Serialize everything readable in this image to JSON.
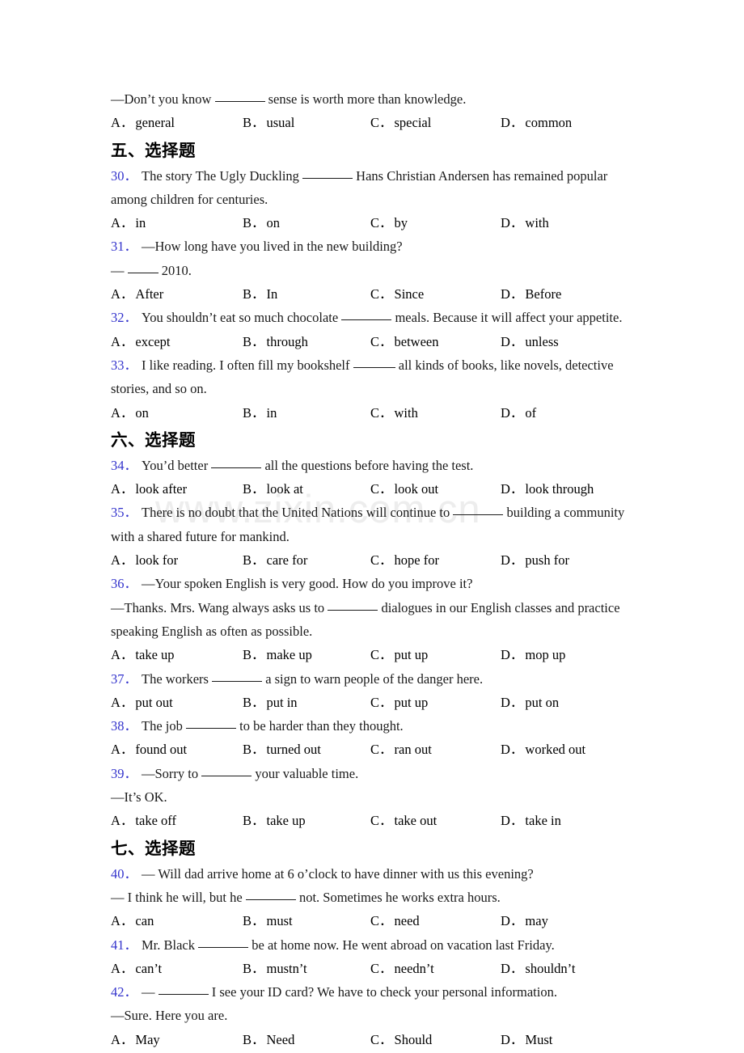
{
  "page": {
    "watermark": "www.zixin.com.cn",
    "accent_number_color": "#3333cc",
    "text_color": "#1a1a1a",
    "background_color": "#ffffff"
  },
  "intro": {
    "stem": "—Don’t you know ________ sense is worth more than knowledge.",
    "stem_pre": "—Don’t you know",
    "stem_post": "sense is worth more than knowledge.",
    "options": [
      {
        "tag": "A．",
        "text": "general"
      },
      {
        "tag": "B．",
        "text": "usual"
      },
      {
        "tag": "C．",
        "text": "special"
      },
      {
        "tag": "D．",
        "text": "common"
      }
    ]
  },
  "sections": [
    {
      "heading": "五、选择题",
      "questions": [
        {
          "number": "30．",
          "lines": [
            {
              "pre": "The story The Ugly Duckling",
              "blank": "b-lg",
              "post": "Hans Christian Andersen has remained popular"
            },
            {
              "pre": "among children for centuries.",
              "blank": null,
              "post": ""
            }
          ],
          "options": [
            {
              "tag": "A．",
              "text": "in"
            },
            {
              "tag": "B．",
              "text": "on"
            },
            {
              "tag": "C．",
              "text": "by"
            },
            {
              "tag": "D．",
              "text": "with"
            }
          ]
        },
        {
          "number": "31．",
          "lines": [
            {
              "pre": "—How long have you lived in the new building?",
              "blank": null,
              "post": ""
            },
            {
              "pre": "—",
              "blank": "b-sm",
              "post": "2010."
            }
          ],
          "options": [
            {
              "tag": "A．",
              "text": "After"
            },
            {
              "tag": "B．",
              "text": "In"
            },
            {
              "tag": "C．",
              "text": "Since"
            },
            {
              "tag": "D．",
              "text": "Before"
            }
          ]
        },
        {
          "number": "32．",
          "lines": [
            {
              "pre": "You shouldn’t eat so much chocolate",
              "blank": "b-lg",
              "post": "meals. Because it will affect your appetite."
            }
          ],
          "options": [
            {
              "tag": "A．",
              "text": "except"
            },
            {
              "tag": "B．",
              "text": "through"
            },
            {
              "tag": "C．",
              "text": "between"
            },
            {
              "tag": "D．",
              "text": "unless"
            }
          ]
        },
        {
          "number": "33．",
          "lines": [
            {
              "pre": "I like reading. I often fill my bookshelf",
              "blank": "b-md",
              "post": "all kinds of books, like novels, detective"
            },
            {
              "pre": "stories, and so on.",
              "blank": null,
              "post": ""
            }
          ],
          "options": [
            {
              "tag": "A．",
              "text": "on"
            },
            {
              "tag": "B．",
              "text": "in"
            },
            {
              "tag": "C．",
              "text": "with"
            },
            {
              "tag": "D．",
              "text": "of"
            }
          ]
        }
      ]
    },
    {
      "heading": "六、选择题",
      "questions": [
        {
          "number": "34．",
          "lines": [
            {
              "pre": "You’d better",
              "blank": "b-lg",
              "post": "all the questions before having the test."
            }
          ],
          "options": [
            {
              "tag": "A．",
              "text": "look after"
            },
            {
              "tag": "B．",
              "text": "look at"
            },
            {
              "tag": "C．",
              "text": "look out"
            },
            {
              "tag": "D．",
              "text": "look through"
            }
          ]
        },
        {
          "number": "35．",
          "lines": [
            {
              "pre": "There is no doubt that the United Nations will continue to",
              "blank": "b-lg",
              "post": "building a community"
            },
            {
              "pre": "with a shared future for mankind.",
              "blank": null,
              "post": ""
            }
          ],
          "options": [
            {
              "tag": "A．",
              "text": "look for"
            },
            {
              "tag": "B．",
              "text": "care for"
            },
            {
              "tag": "C．",
              "text": "hope for"
            },
            {
              "tag": "D．",
              "text": "push for"
            }
          ]
        },
        {
          "number": "36．",
          "lines": [
            {
              "pre": "—Your spoken English is very good. How do you improve it?",
              "blank": null,
              "post": ""
            },
            {
              "pre": "—Thanks. Mrs. Wang always asks us to",
              "blank": "b-lg",
              "post": "dialogues in our English classes and practice"
            },
            {
              "pre": "speaking English as often as possible.",
              "blank": null,
              "post": ""
            }
          ],
          "options": [
            {
              "tag": "A．",
              "text": "take up"
            },
            {
              "tag": "B．",
              "text": "make up"
            },
            {
              "tag": "C．",
              "text": "put up"
            },
            {
              "tag": "D．",
              "text": "mop up"
            }
          ]
        },
        {
          "number": "37．",
          "lines": [
            {
              "pre": "The workers",
              "blank": "b-lg",
              "post": "a sign to warn people of the danger here."
            }
          ],
          "options": [
            {
              "tag": "A．",
              "text": "put out"
            },
            {
              "tag": "B．",
              "text": "put in"
            },
            {
              "tag": "C．",
              "text": "put up"
            },
            {
              "tag": "D．",
              "text": "put on"
            }
          ]
        },
        {
          "number": "38．",
          "lines": [
            {
              "pre": "The job",
              "blank": "b-lg",
              "post": "to be harder than they thought."
            }
          ],
          "options": [
            {
              "tag": "A．",
              "text": "found out"
            },
            {
              "tag": "B．",
              "text": "turned out"
            },
            {
              "tag": "C．",
              "text": "ran out"
            },
            {
              "tag": "D．",
              "text": "worked out"
            }
          ]
        },
        {
          "number": "39．",
          "lines": [
            {
              "pre": "—Sorry to",
              "blank": "b-lg",
              "post": "your valuable time."
            },
            {
              "pre": "—It’s OK.",
              "blank": null,
              "post": ""
            }
          ],
          "options": [
            {
              "tag": "A．",
              "text": "take off"
            },
            {
              "tag": "B．",
              "text": "take up"
            },
            {
              "tag": "C．",
              "text": "take out"
            },
            {
              "tag": "D．",
              "text": "take in"
            }
          ]
        }
      ]
    },
    {
      "heading": "七、选择题",
      "questions": [
        {
          "number": "40．",
          "lines": [
            {
              "pre": "— Will dad arrive home at 6 o’clock to have dinner with us this evening?",
              "blank": null,
              "post": ""
            },
            {
              "pre": "— I think he will, but he",
              "blank": "b-lg",
              "post": "not. Sometimes he works extra hours."
            }
          ],
          "options": [
            {
              "tag": "A．",
              "text": "can"
            },
            {
              "tag": "B．",
              "text": "must"
            },
            {
              "tag": "C．",
              "text": "need"
            },
            {
              "tag": "D．",
              "text": "may"
            }
          ]
        },
        {
          "number": "41．",
          "lines": [
            {
              "pre": "Mr. Black",
              "blank": "b-lg",
              "post": "be at home now. He went abroad on vacation last Friday."
            }
          ],
          "options": [
            {
              "tag": "A．",
              "text": "can’t"
            },
            {
              "tag": "B．",
              "text": "mustn’t"
            },
            {
              "tag": "C．",
              "text": "needn’t"
            },
            {
              "tag": "D．",
              "text": "shouldn’t"
            }
          ]
        },
        {
          "number": "42．",
          "lines": [
            {
              "pre": "—",
              "blank": "b-lg",
              "post": "I see your ID card? We have to check your personal information."
            },
            {
              "pre": "—Sure. Here you are.",
              "blank": null,
              "post": ""
            }
          ],
          "options": [
            {
              "tag": "A．",
              "text": "May"
            },
            {
              "tag": "B．",
              "text": "Need"
            },
            {
              "tag": "C．",
              "text": "Should"
            },
            {
              "tag": "D．",
              "text": "Must"
            }
          ]
        }
      ]
    }
  ]
}
